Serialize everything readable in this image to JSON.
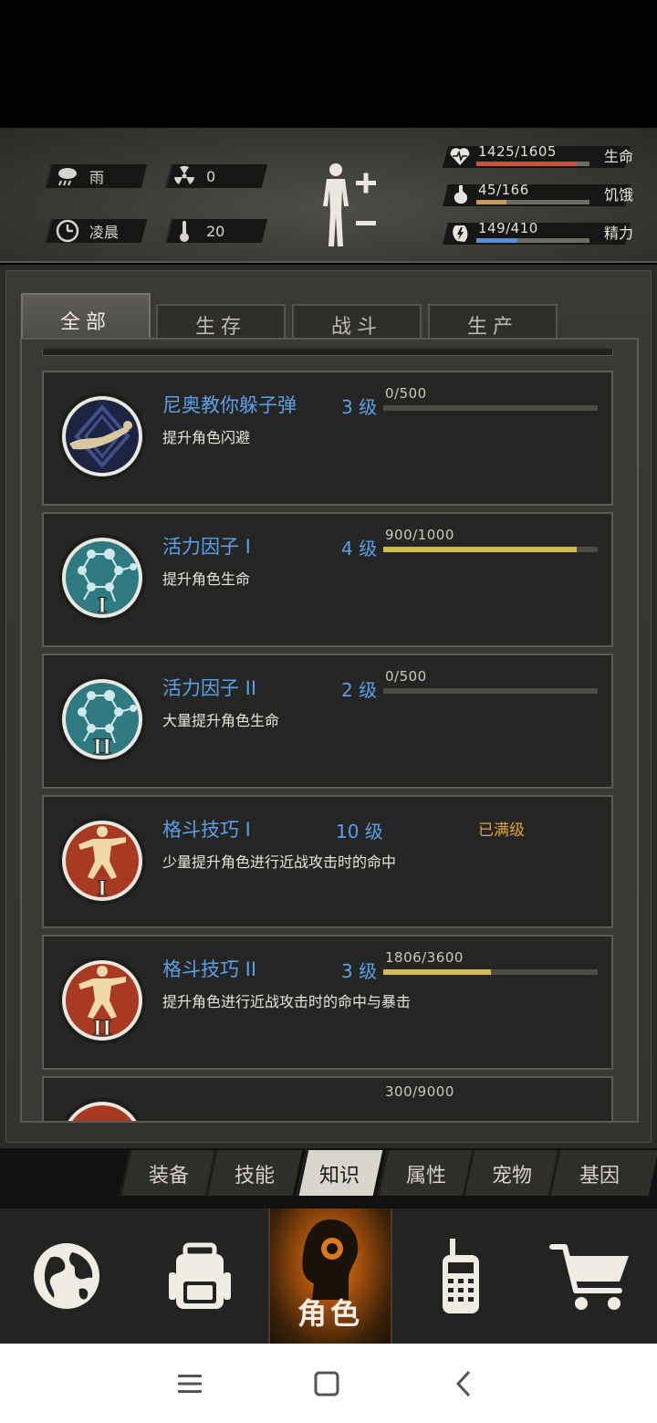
{
  "weather": {
    "label": "雨",
    "radiation": "0",
    "time": "凌晨",
    "temperature": "20"
  },
  "vitals": [
    {
      "value": "1425/1605",
      "label": "生命",
      "fill_fraction": 0.89,
      "color": "#d0513f",
      "icon": "heart-icon"
    },
    {
      "value": "45/166",
      "label": "饥饿",
      "fill_fraction": 0.27,
      "color": "#c79a54",
      "icon": "stomach-icon"
    },
    {
      "value": "149/410",
      "label": "精力",
      "fill_fraction": 0.36,
      "color": "#5a8ed2",
      "icon": "energy-icon"
    }
  ],
  "category_tabs": [
    "全部",
    "生存",
    "战斗",
    "生产"
  ],
  "knowledge": [
    {
      "name": "尼奥教你躲子弹",
      "level": "3 级",
      "progress": "0/500",
      "fill_fraction": 0.0,
      "desc": "提升角色闪避",
      "icon": "dodge-icon"
    },
    {
      "name": "活力因子 I",
      "level": "4 级",
      "progress": "900/1000",
      "fill_fraction": 0.9,
      "desc": "提升角色生命",
      "icon": "molecule-icon"
    },
    {
      "name": "活力因子 II",
      "level": "2 级",
      "progress": "0/500",
      "fill_fraction": 0.0,
      "desc": "大量提升角色生命",
      "icon": "molecule-icon"
    },
    {
      "name": "格斗技巧 I",
      "level": "10 级",
      "max_text": "已满级",
      "desc": "少量提升角色进行近战攻击时的命中",
      "icon": "fighter-icon"
    },
    {
      "name": "格斗技巧 II",
      "level": "3 级",
      "progress": "1806/3600",
      "fill_fraction": 0.5,
      "desc": "提升角色进行近战攻击时的命中与暴击",
      "icon": "fighter-icon"
    },
    {
      "progress": "300/9000"
    }
  ],
  "sub_tabs": [
    "装备",
    "技能",
    "知识",
    "属性",
    "宠物",
    "基因"
  ],
  "sub_tabs_active": "知识",
  "bottom_nav": {
    "active_label": "角色"
  }
}
